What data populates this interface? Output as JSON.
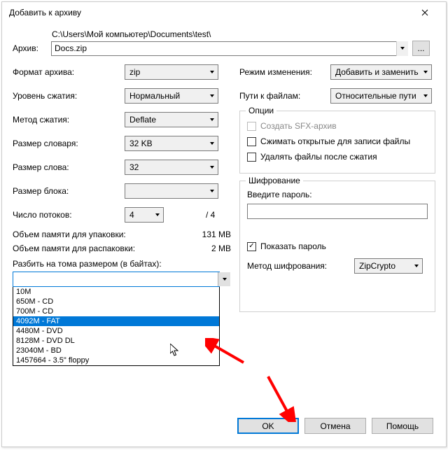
{
  "window": {
    "title": "Добавить к архиву"
  },
  "archive": {
    "label": "Архив:",
    "path": "C:\\Users\\Мой компьютер\\Documents\\test\\",
    "filename": "Docs.zip",
    "browse": "..."
  },
  "left": {
    "format_label": "Формат архива:",
    "format_value": "zip",
    "level_label": "Уровень сжатия:",
    "level_value": "Нормальный",
    "method_label": "Метод сжатия:",
    "method_value": "Deflate",
    "dict_label": "Размер словаря:",
    "dict_value": "32 KB",
    "word_label": "Размер слова:",
    "word_value": "32",
    "block_label": "Размер блока:",
    "block_value": "",
    "threads_label": "Число потоков:",
    "threads_value": "4",
    "threads_total": "/ 4",
    "mem_pack_label": "Объем памяти для упаковки:",
    "mem_pack_value": "131 MB",
    "mem_unpack_label": "Объем памяти для распаковки:",
    "mem_unpack_value": "2 MB",
    "split_label": "Разбить на тома размером (в байтах):",
    "split_value": "",
    "split_options": [
      "10M",
      "650M - CD",
      "700M - CD",
      "4092M - FAT",
      "4480M - DVD",
      "8128M - DVD DL",
      "23040M - BD",
      "1457664 - 3.5\" floppy"
    ]
  },
  "right": {
    "update_label": "Режим изменения:",
    "update_value": "Добавить и заменить",
    "paths_label": "Пути к файлам:",
    "paths_value": "Относительные пути",
    "options_legend": "Опции",
    "sfx_label": "Создать SFX-архив",
    "compress_shared_label": "Сжимать открытые для записи файлы",
    "delete_after_label": "Удалять файлы после сжатия",
    "encryption_legend": "Шифрование",
    "password_label": "Введите пароль:",
    "show_password_label": "Показать пароль",
    "enc_method_label": "Метод шифрования:",
    "enc_method_value": "ZipCrypto"
  },
  "buttons": {
    "ok": "OK",
    "cancel": "Отмена",
    "help": "Помощь"
  }
}
